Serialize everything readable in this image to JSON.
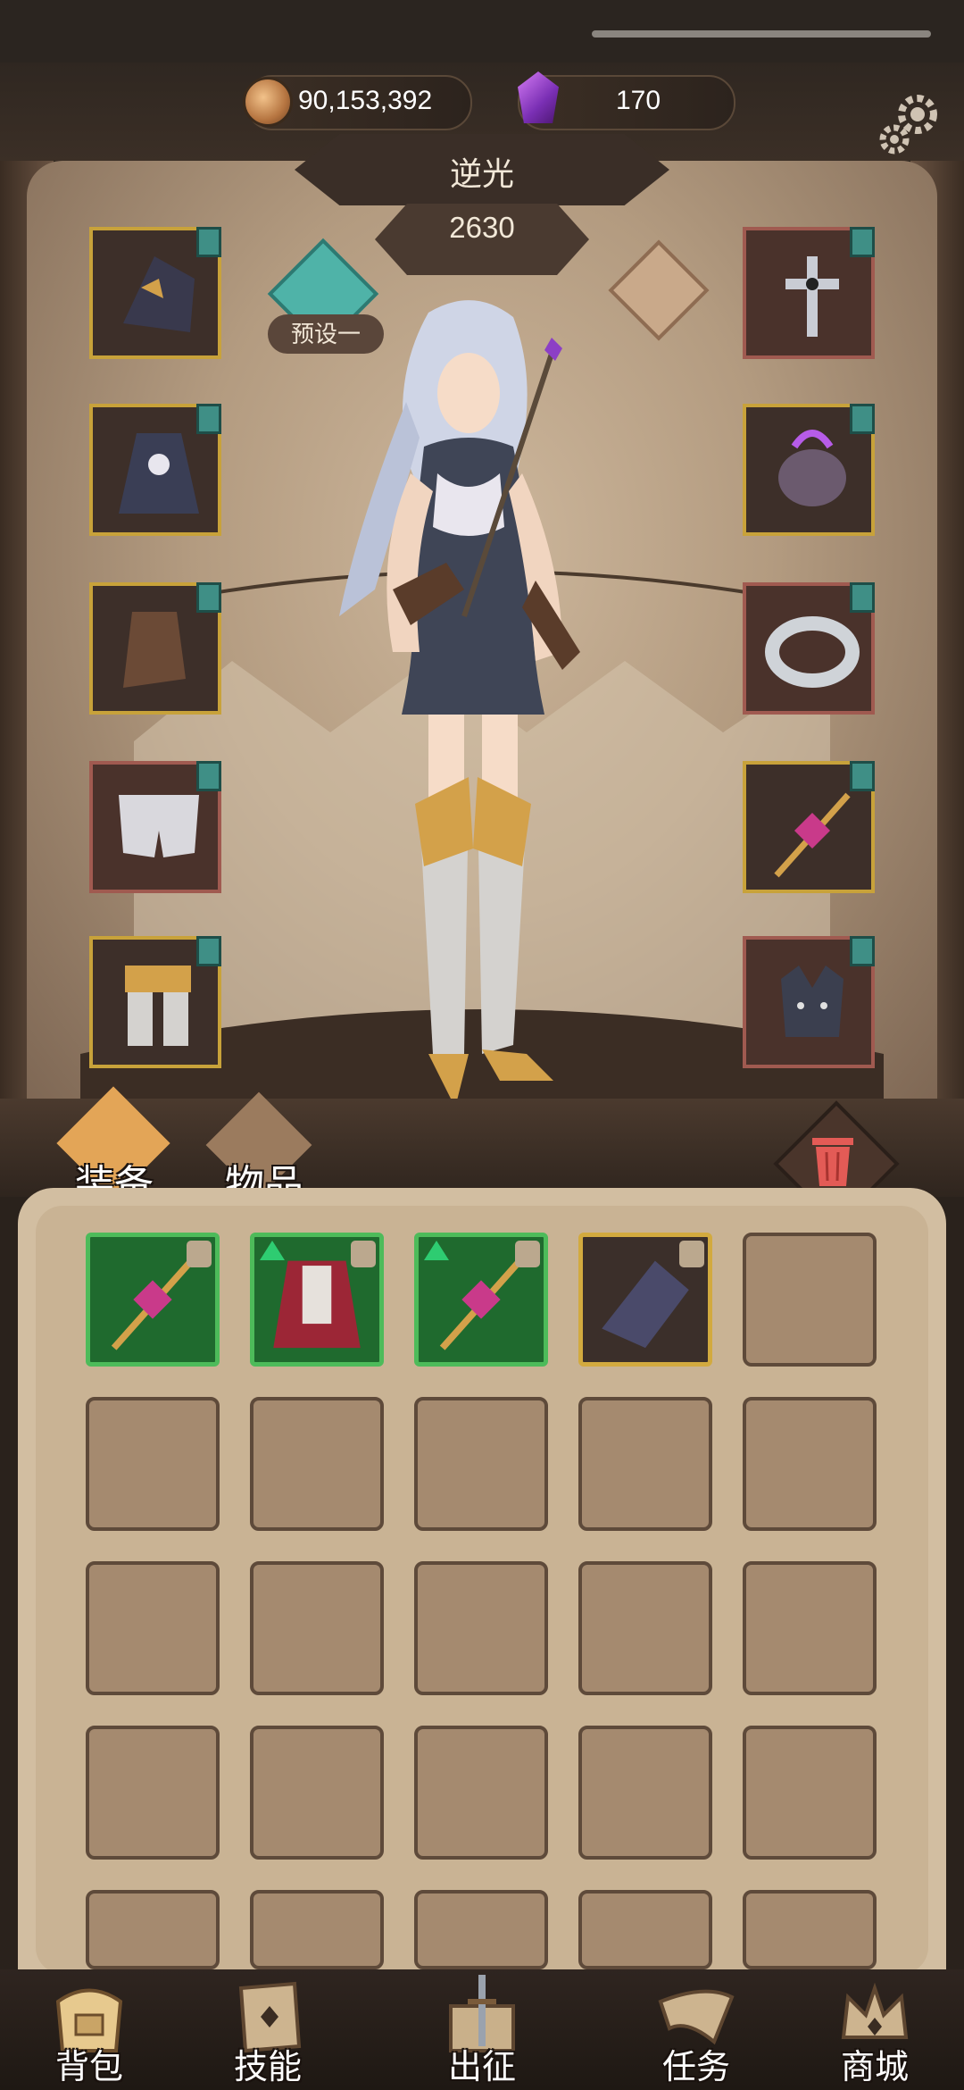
{
  "header": {
    "coins": "90,153,392",
    "gems": "170"
  },
  "character": {
    "name": "逆光",
    "power": "2630",
    "preset_label": "预设一"
  },
  "equipment_left": [
    {
      "slot": "helmet",
      "icon": "horned-hood-icon",
      "frame": "gold"
    },
    {
      "slot": "armor",
      "icon": "dark-dress-armor-icon",
      "frame": "gold"
    },
    {
      "slot": "gloves",
      "icon": "leather-gauntlet-icon",
      "frame": "gold"
    },
    {
      "slot": "pants",
      "icon": "white-bloomers-icon",
      "frame": "red"
    },
    {
      "slot": "boots",
      "icon": "golden-greaves-icon",
      "frame": "gold"
    }
  ],
  "equipment_right": [
    {
      "slot": "necklace",
      "icon": "cross-pendant-icon",
      "frame": "red"
    },
    {
      "slot": "pauldron",
      "icon": "purple-flame-skull-icon",
      "frame": "gold"
    },
    {
      "slot": "ring",
      "icon": "silver-ring-icon",
      "frame": "red"
    },
    {
      "slot": "weapon",
      "icon": "crystal-staff-icon",
      "frame": "gold"
    },
    {
      "slot": "companion",
      "icon": "wolf-head-icon",
      "frame": "red"
    }
  ],
  "tabs": {
    "equipment": "装备",
    "items": "物品"
  },
  "inventory": {
    "items": [
      {
        "icon": "crystal-staff-icon",
        "frame": "green",
        "upgrade": false,
        "locked": true
      },
      {
        "icon": "red-robe-icon",
        "frame": "green",
        "upgrade": true,
        "locked": true
      },
      {
        "icon": "crystal-staff-icon",
        "frame": "green",
        "upgrade": true,
        "locked": true
      },
      {
        "icon": "dark-gauntlet-icon",
        "frame": "gold",
        "upgrade": false,
        "locked": true
      }
    ]
  },
  "nav": {
    "backpack": "背包",
    "skills": "技能",
    "expedition": "出征",
    "quests": "任务",
    "shop": "商城"
  },
  "colors": {
    "accent_teal": "#4fb3a8",
    "rare_green": "#4dbb5a",
    "epic_gold": "#d2aa3f",
    "parchment": "#c9b394"
  }
}
